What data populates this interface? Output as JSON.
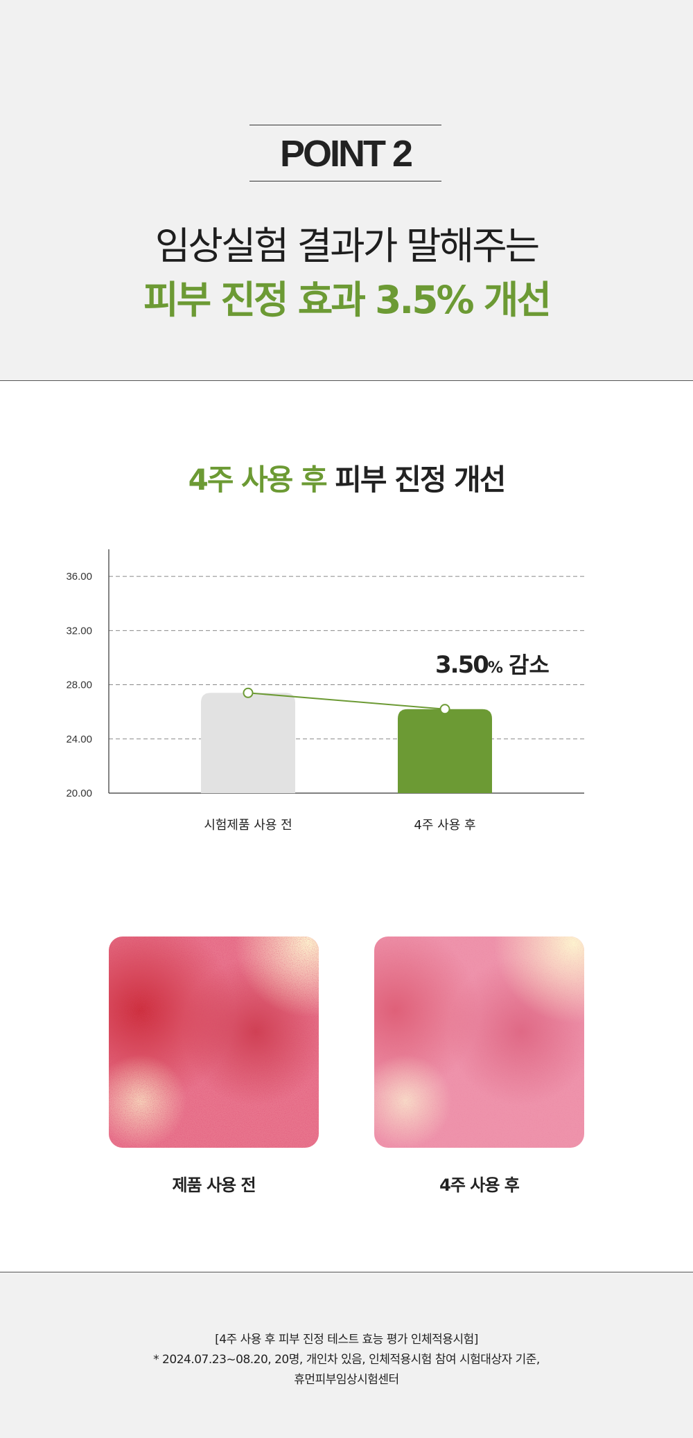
{
  "header": {
    "point_label": "POINT 2",
    "headline_line1": "임상실험 결과가 말해주는",
    "headline_line2": "피부 진정 효과 3.5% 개선"
  },
  "chart_section": {
    "title_accent": "4주 사용 후",
    "title_rest": "피부 진정 개선"
  },
  "chart_data": {
    "type": "bar",
    "categories": [
      "시험제품 사용 전",
      "4주 사용 후"
    ],
    "values": [
      27.4,
      26.2
    ],
    "ylim": [
      20,
      38
    ],
    "yticks": [
      "20.00",
      "24.00",
      "28.00",
      "32.00",
      "36.00"
    ],
    "ytick_values": [
      20,
      24,
      28,
      32,
      36
    ],
    "grid": true,
    "bar_colors": [
      "#e2e2e2",
      "#6c9a34"
    ],
    "line_color": "#6c9a34",
    "annotation_value": "3.50",
    "annotation_unit": "%",
    "annotation_text": "감소"
  },
  "photos": {
    "before_label": "제품 사용 전",
    "after_label": "4주 사용 후"
  },
  "footnote": {
    "line1": "[4주 사용 후 피부 진정 테스트 효능 평가 인체적용시험]",
    "line2": "* 2024.07.23~08.20, 20명, 개인차 있음, 인체적용시험 참여 시험대상자 기준,",
    "line3": "휴먼피부임상시험센터"
  }
}
